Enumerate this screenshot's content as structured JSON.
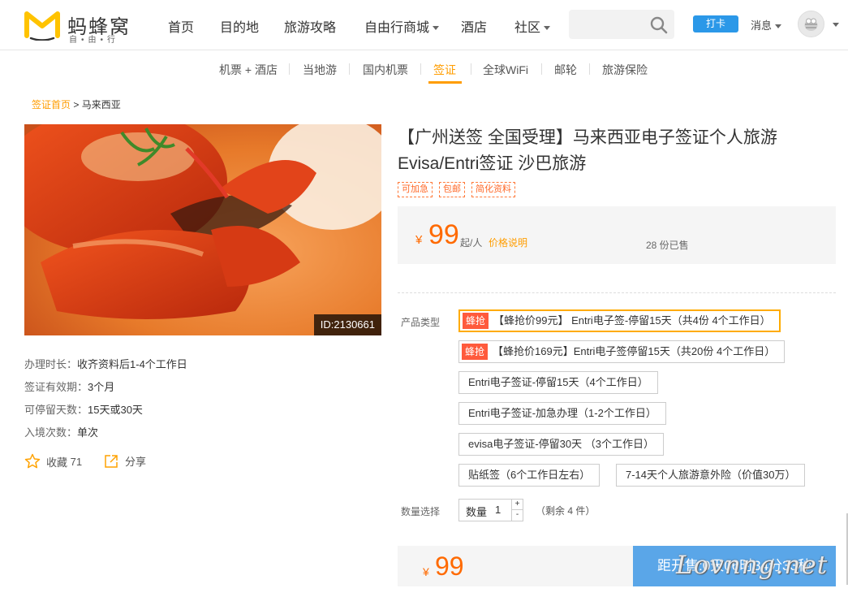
{
  "header": {
    "logo": {
      "name": "蚂蜂窝",
      "sub": "自•由•行",
      "icon": "mafengwo-logo-icon",
      "color": "#ffc300"
    },
    "nav": [
      {
        "label": "首页",
        "dropdown": false
      },
      {
        "label": "目的地",
        "dropdown": false
      },
      {
        "label": "旅游攻略",
        "dropdown": false
      },
      {
        "label": "自由行商城",
        "dropdown": true
      },
      {
        "label": "酒店",
        "dropdown": false
      },
      {
        "label": "社区",
        "dropdown": true
      }
    ],
    "search": {
      "placeholder": "",
      "icon": "search-icon"
    },
    "checkin_label": "打卡",
    "message_label": "消息",
    "avatar_icon": "user-avatar-icon"
  },
  "subnav": {
    "items": [
      "机票 + 酒店",
      "当地游",
      "国内机票",
      "签证",
      "全球WiFi",
      "邮轮",
      "旅游保险"
    ],
    "active": "签证",
    "accent": "#ff9d00"
  },
  "breadcrumb": {
    "root": "签证首页",
    "separator": " > ",
    "current": "马来西亚"
  },
  "product": {
    "image_id": "ID:2130661",
    "title": "【广州送签 全国受理】马来西亚电子签证个人旅游Evisa/Entri签证 沙巴旅游",
    "tags": [
      "可加急",
      "包邮",
      "简化资料"
    ],
    "price": {
      "currency": "¥",
      "amount": "99",
      "unit": "起/人",
      "explain_link": "价格说明",
      "sold": "28 份已售"
    },
    "info": [
      {
        "key": "办理时长：",
        "value": "收齐资料后1-4个工作日"
      },
      {
        "key": "签证有效期：",
        "value": "3个月"
      },
      {
        "key": "可停留天数：",
        "value": "15天或30天"
      },
      {
        "key": "入境次数：",
        "value": "单次"
      }
    ],
    "collect": {
      "label": "收藏",
      "count": "71",
      "icon": "star-icon"
    },
    "share": {
      "label": "分享",
      "icon": "share-icon"
    }
  },
  "options": {
    "type_label": "产品类型",
    "badge": "蜂抢",
    "items": [
      "【蜂抢价99元】 Entri电子签-停留15天（共4份 4个工作日）",
      "【蜂抢价169元】Entri电子签停留15天（共20份 4个工作日）",
      "Entri电子签证-停留15天（4个工作日）",
      "Entri电子签证-加急办理（1-2个工作日）",
      "evisa电子签证-停留30天 （3个工作日）",
      "贴纸签（6个工作日左右）",
      "7-14天个人旅游意外险（价值30万）"
    ],
    "selected_index": 0
  },
  "quantity": {
    "label": "数量选择",
    "field_label": "数量",
    "value": "1",
    "plus": "+",
    "minus": "-",
    "remaining": "（剩余 4 件）"
  },
  "purchase": {
    "currency": "¥",
    "amount": "99",
    "countdown": "距开售:0天06时34分33秒"
  },
  "watermark": "Lovnng.net"
}
